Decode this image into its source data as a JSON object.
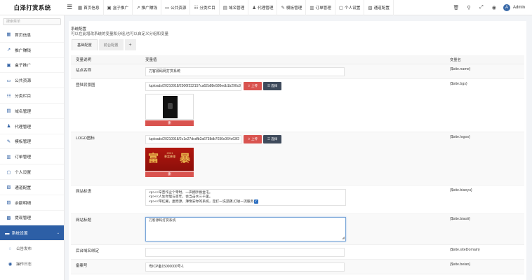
{
  "app": {
    "title": "白泽打赏系统"
  },
  "topnav": [
    {
      "label": "首页信息",
      "icon": "home-icon"
    },
    {
      "label": "盒子推广",
      "icon": "box-icon"
    },
    {
      "label": "推广赚钱",
      "icon": "share-icon"
    },
    {
      "label": "公共资源",
      "icon": "folder-icon"
    },
    {
      "label": "分类栏目",
      "icon": "list-icon"
    },
    {
      "label": "域名管理",
      "icon": "domain-icon"
    },
    {
      "label": "代理管理",
      "icon": "agent-icon"
    },
    {
      "label": "模板管理",
      "icon": "template-icon"
    },
    {
      "label": "订单管理",
      "icon": "order-icon"
    },
    {
      "label": "个人设置",
      "icon": "user-icon"
    },
    {
      "label": "通道配置",
      "icon": "channel-icon"
    }
  ],
  "header_right": {
    "user": "Admin",
    "avatar_letter": "A"
  },
  "sidebar": {
    "search_placeholder": "搜索菜单",
    "items": [
      {
        "label": "首页信息"
      },
      {
        "label": "推广赚钱"
      },
      {
        "label": "盒子推广"
      },
      {
        "label": "公共资源"
      },
      {
        "label": "分类栏目"
      },
      {
        "label": "域名管理"
      },
      {
        "label": "代理管理"
      },
      {
        "label": "模板管理"
      },
      {
        "label": "订单管理"
      },
      {
        "label": "个人设置"
      },
      {
        "label": "通道配置"
      },
      {
        "label": "余额明细"
      },
      {
        "label": "提现管理"
      },
      {
        "label": "系统设置"
      }
    ],
    "subitems": [
      {
        "label": "公告发布"
      },
      {
        "label": "操作日志"
      }
    ]
  },
  "main": {
    "title": "系统配置",
    "desc": "可以在此增改系统的变量和分组,也可以自定义分组和变量",
    "tabs": [
      "基础配置",
      "前台配置",
      "+"
    ],
    "columns": [
      "变量说明",
      "变量值",
      "变量名"
    ],
    "rows": {
      "site_name": {
        "label": "站点名称",
        "value": "刀客源码网打赏系统",
        "var": "{$site.name}"
      },
      "bgs": {
        "label": "登陆背景图",
        "value": "/uploads/20210918/2506f232157ca62b88e586edb1b290c8",
        "var": "{$site.bgs}",
        "upload": "上传",
        "select": "选择",
        "delete": "删"
      },
      "logo": {
        "label": "LOGO图标",
        "value": "/uploads/20210918/2c1e27dcdfb2a6738db7036c064c63f2",
        "var": "{$site.logos}",
        "upload": "上传",
        "select": "选择",
        "delete": "删",
        "logo_left": "富",
        "logo_mid_1": "2021",
        "logo_mid_2": "暴富暴赚",
        "logo_right": "暴"
      },
      "keywords": {
        "label": "网站标语",
        "line1": "<p><<辛苦作业个零时，一声拥手换金屯。",
        "line2": "<p><<人生你理与百年，会当击水三千里。",
        "line3": "<p><<带红翼，蛋而源，薄惰安你的系统，定打一洗菜藕,打进一流服务",
        "var": "{$site.biaoyu}"
      },
      "title": {
        "label": "网站标题",
        "value": "刀客源码打赏系统",
        "var": "{$site.biaoti}"
      },
      "domain": {
        "label": "后台域名绑定",
        "value": "",
        "var": "{$site.siteDomain}"
      },
      "beian": {
        "label": "备案号",
        "value": "粤ICP备15000000号-1",
        "var": "{$site.beian}"
      }
    }
  },
  "colors": {
    "accent": "#2d5fa6",
    "danger": "#d9534f",
    "dark": "#3e4a5b"
  }
}
